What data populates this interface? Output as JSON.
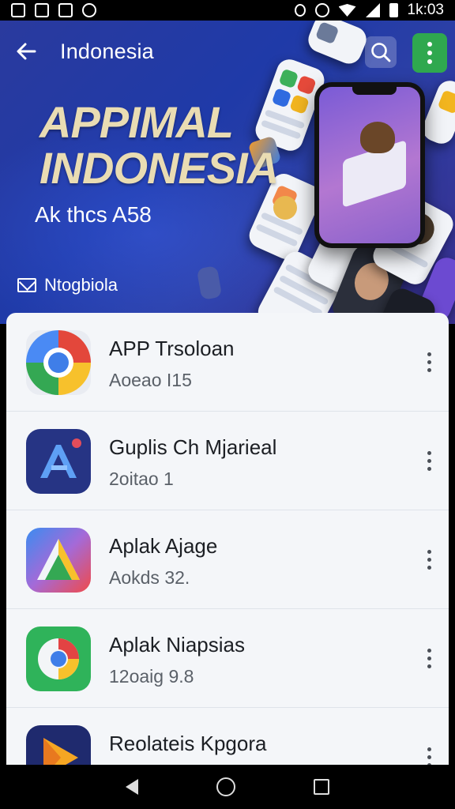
{
  "status_bar": {
    "time": "1k:03"
  },
  "header": {
    "title": "Indonesia"
  },
  "banner": {
    "title_line1": "APPIMAL",
    "title_line2": "INDONESIA",
    "subtitle": "Ak thcs A58",
    "tag": "Ntogbiola"
  },
  "apps": [
    {
      "name": "APP Trsoloan",
      "detail": "Aoeao I15"
    },
    {
      "name": "Guplis Ch Mjarieal",
      "detail": "2oitao 1"
    },
    {
      "name": "Aplak Ajage",
      "detail": "Aokds 32."
    },
    {
      "name": "Aplak Niapsias",
      "detail": "12oaig 9.8"
    },
    {
      "name": "Reolateis Kpgora",
      "detail": ""
    }
  ],
  "icons": {
    "back": "arrow-left-icon",
    "search": "search-icon",
    "more": "more-vert-icon",
    "tag": "mail-icon"
  },
  "colors": {
    "banner_bg": "#1f3aa8",
    "title_gold": "#e9dcb3",
    "more_btn": "#2fa84f",
    "list_bg": "#f4f6f9"
  }
}
